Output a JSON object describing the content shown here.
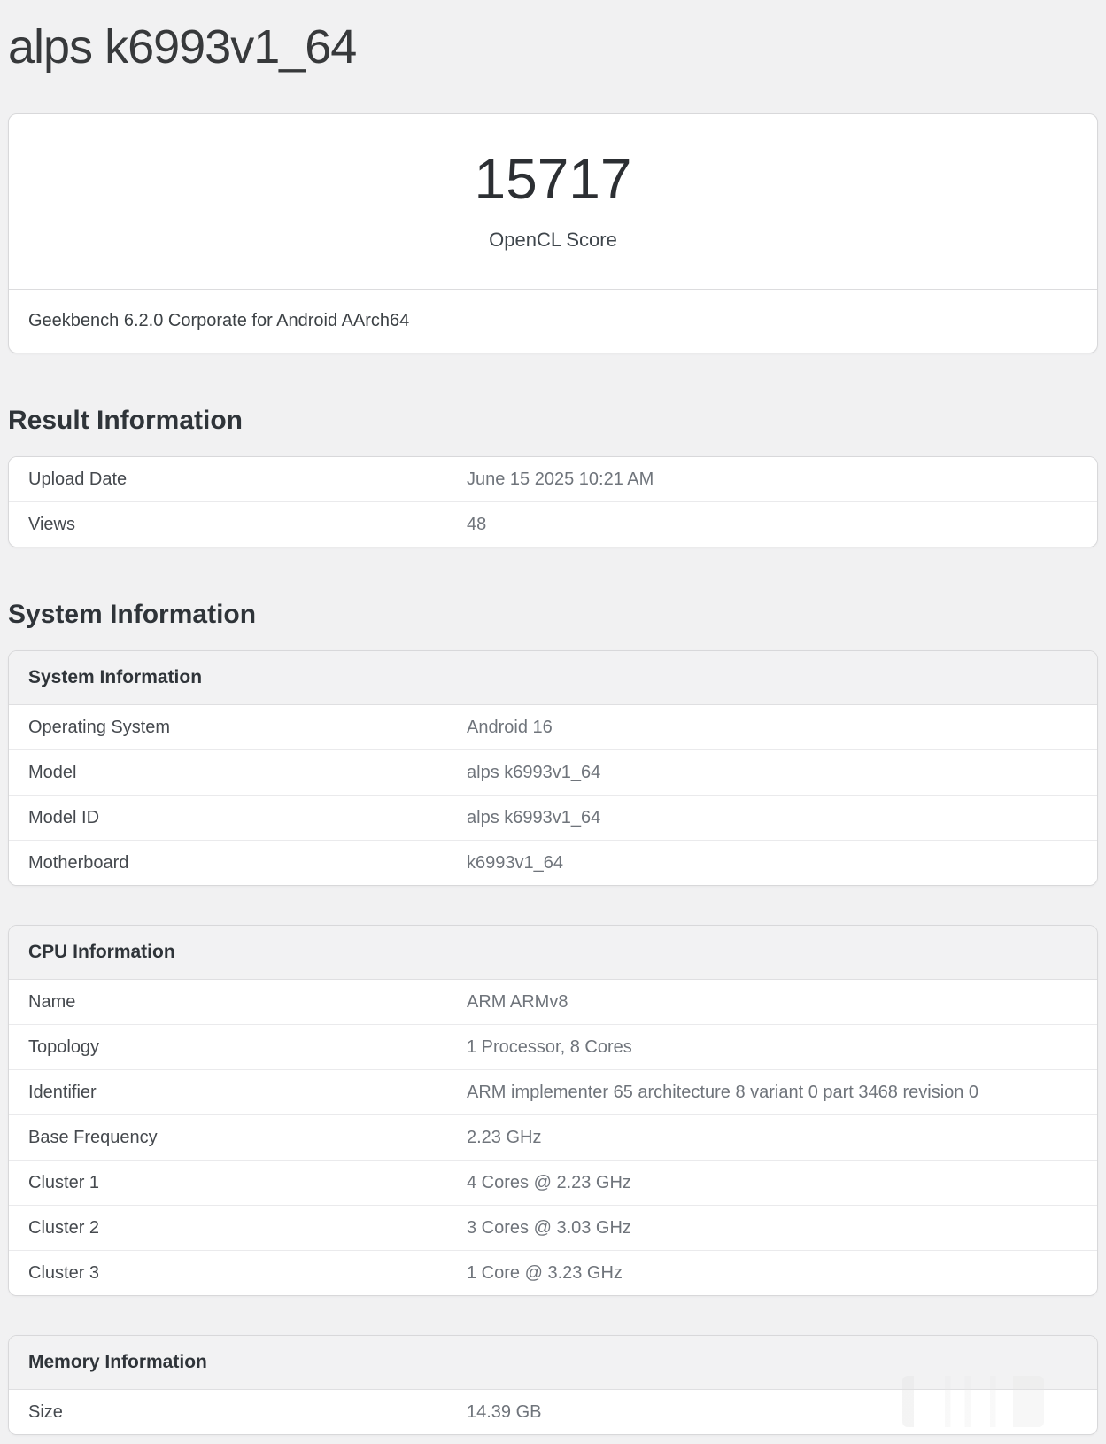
{
  "page": {
    "title": "alps k6993v1_64"
  },
  "score_card": {
    "score": "15717",
    "score_label": "OpenCL Score",
    "footer": "Geekbench 6.2.0 Corporate for Android AArch64"
  },
  "section_headings": {
    "result": "Result Information",
    "system": "System Information"
  },
  "cards": {
    "result": {
      "rows": [
        {
          "label": "Upload Date",
          "value": "June 15 2025 10:21 AM"
        },
        {
          "label": "Views",
          "value": "48"
        }
      ]
    },
    "system": {
      "header": "System Information",
      "rows": [
        {
          "label": "Operating System",
          "value": "Android 16"
        },
        {
          "label": "Model",
          "value": "alps k6993v1_64"
        },
        {
          "label": "Model ID",
          "value": "alps k6993v1_64"
        },
        {
          "label": "Motherboard",
          "value": "k6993v1_64"
        }
      ]
    },
    "cpu": {
      "header": "CPU Information",
      "rows": [
        {
          "label": "Name",
          "value": "ARM ARMv8"
        },
        {
          "label": "Topology",
          "value": "1 Processor, 8 Cores"
        },
        {
          "label": "Identifier",
          "value": "ARM implementer 65 architecture 8 variant 0 part 3468 revision 0"
        },
        {
          "label": "Base Frequency",
          "value": "2.23 GHz"
        },
        {
          "label": "Cluster 1",
          "value": "4 Cores @ 2.23 GHz"
        },
        {
          "label": "Cluster 2",
          "value": "3 Cores @ 3.03 GHz"
        },
        {
          "label": "Cluster 3",
          "value": "1 Core @ 3.23 GHz"
        }
      ]
    },
    "memory": {
      "header": "Memory Information",
      "rows": [
        {
          "label": "Size",
          "value": "14.39 GB"
        }
      ]
    }
  },
  "colors": {
    "page_bg": "#f1f1f2",
    "card_bg": "#ffffff",
    "card_border": "#d8d8da",
    "card_header_bg": "#f2f2f3",
    "label_text": "#45494e",
    "value_text": "#6f747b",
    "heading_text": "#2f3439"
  }
}
